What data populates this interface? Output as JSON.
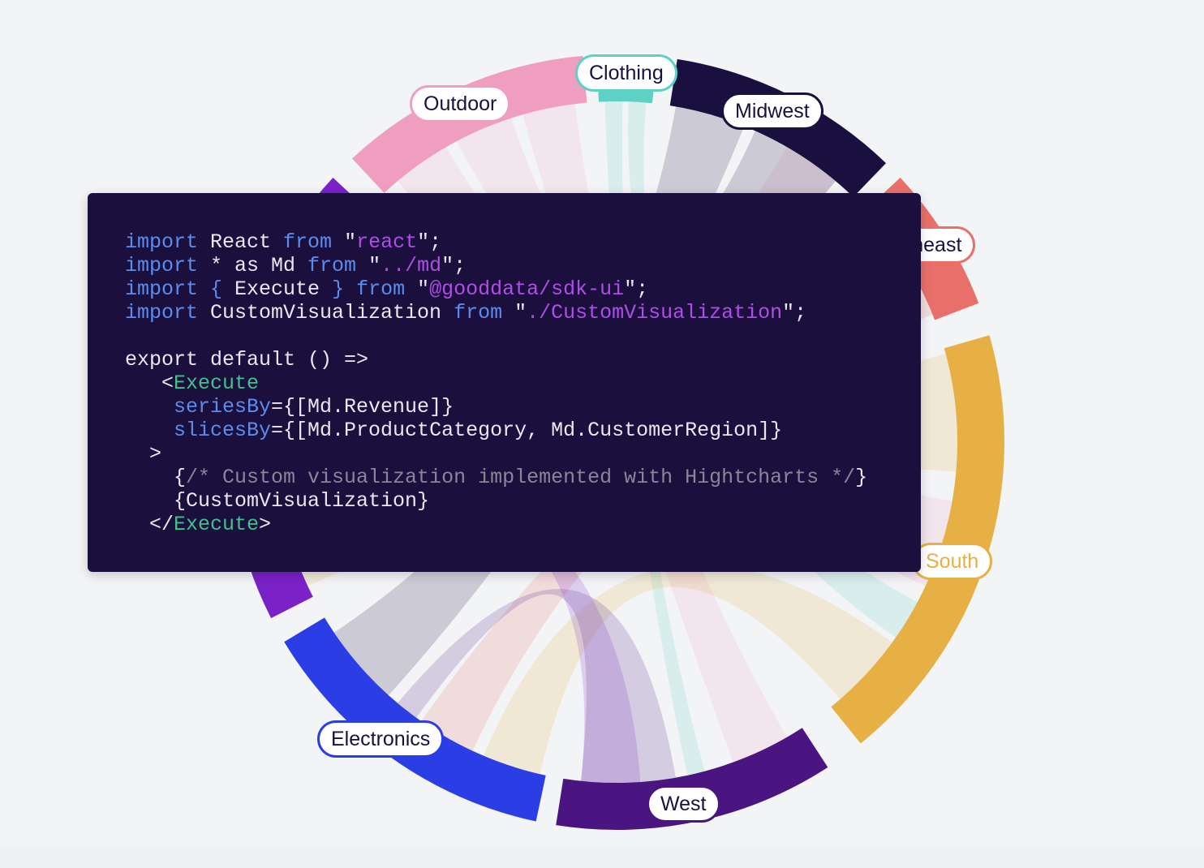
{
  "wheel": {
    "nodes": [
      {
        "id": "outdoor",
        "label": "Outdoor",
        "color": "#f09ec0",
        "text_color": "#1a1040"
      },
      {
        "id": "clothing",
        "label": "Clothing",
        "color": "#5ed0c4",
        "text_color": "#1a1040"
      },
      {
        "id": "midwest",
        "label": "Midwest",
        "color": "#1a1040",
        "text_color": "#1a1040"
      },
      {
        "id": "northeast",
        "label": "Northeast",
        "color": "#e9706a",
        "text_color": "#1a1040"
      },
      {
        "id": "south",
        "label": "South",
        "color": "#e6b045",
        "text_color": "#e6b045"
      },
      {
        "id": "west",
        "label": "West",
        "color": "#4a1580",
        "text_color": "#1a1040"
      },
      {
        "id": "electronics",
        "label": "Electronics",
        "color": "#2b3ee6",
        "text_color": "#1a1040"
      },
      {
        "id": "home",
        "label": "",
        "color": "#7a22c8",
        "text_color": "#1a1040"
      }
    ]
  },
  "code": {
    "lines": [
      [
        [
          "k",
          "import"
        ],
        [
          "p",
          " React "
        ],
        [
          "k",
          "from"
        ],
        [
          "p",
          " \""
        ],
        [
          "s",
          "react"
        ],
        [
          "p",
          "\";"
        ]
      ],
      [
        [
          "k",
          "import"
        ],
        [
          "p",
          " * as Md "
        ],
        [
          "k",
          "from"
        ],
        [
          "p",
          " \""
        ],
        [
          "s",
          "../md"
        ],
        [
          "p",
          "\";"
        ]
      ],
      [
        [
          "k",
          "import"
        ],
        [
          "k",
          " {"
        ],
        [
          "p",
          " Execute "
        ],
        [
          "k",
          "}"
        ],
        [
          "k",
          " from"
        ],
        [
          "p",
          " \""
        ],
        [
          "s",
          "@gooddata/sdk-ui"
        ],
        [
          "p",
          "\";"
        ]
      ],
      [
        [
          "k",
          "import"
        ],
        [
          "p",
          " CustomVisualization "
        ],
        [
          "k",
          "from"
        ],
        [
          "p",
          " \""
        ],
        [
          "s",
          "./CustomVisualization"
        ],
        [
          "p",
          "\";"
        ]
      ],
      [],
      [
        [
          "p",
          "export default () =>"
        ]
      ],
      [
        [
          "p",
          "   <"
        ],
        [
          "g",
          "Execute"
        ]
      ],
      [
        [
          "k",
          "    seriesBy"
        ],
        [
          "p",
          "={[Md.Revenue]}"
        ]
      ],
      [
        [
          "k",
          "    slicesBy"
        ],
        [
          "p",
          "={[Md.ProductCategory, Md.CustomerRegion]}"
        ]
      ],
      [
        [
          "p",
          "  >"
        ]
      ],
      [
        [
          "p",
          "    {"
        ],
        [
          "c",
          "/* Custom visualization implemented with Hightcharts */"
        ],
        [
          "p",
          "}"
        ]
      ],
      [
        [
          "p",
          "    {CustomVisualization}"
        ]
      ],
      [
        [
          "p",
          "  </"
        ],
        [
          "g",
          "Execute"
        ],
        [
          "p",
          ">"
        ]
      ]
    ]
  }
}
